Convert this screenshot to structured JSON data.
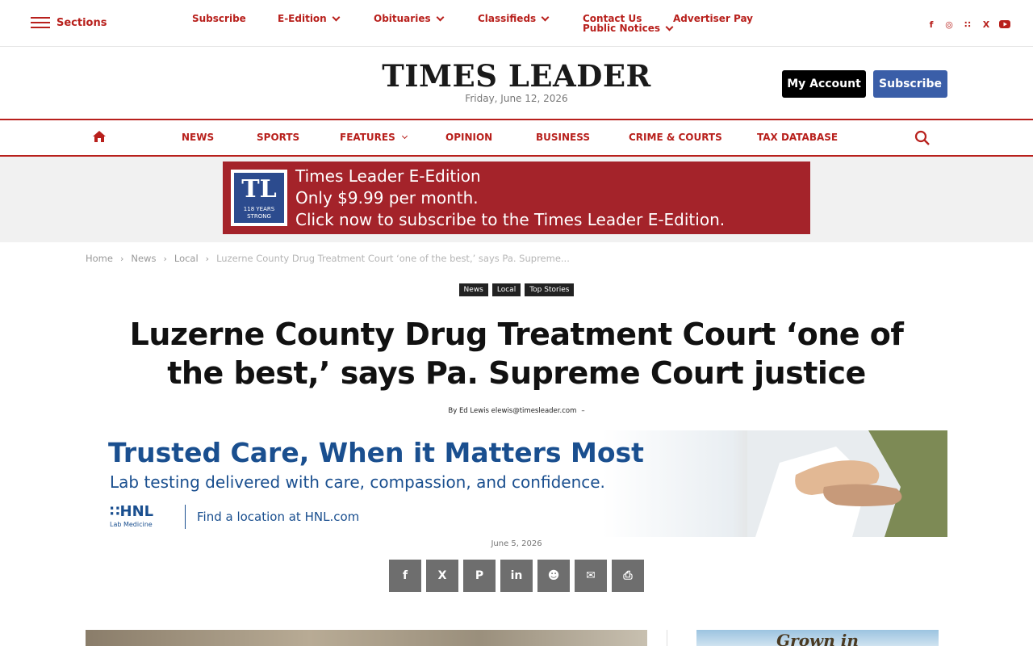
{
  "topbar": {
    "sections_label": "Sections",
    "links": {
      "subscribe": "Subscribe",
      "eedition": "E-Edition",
      "obituaries": "Obituaries",
      "classifieds": "Classifieds",
      "contact_us": "Contact Us",
      "public_notices": "Public Notices",
      "advertiser_pay": "Advertiser Pay"
    },
    "social": {
      "facebook": "f",
      "instagram": "◎",
      "rss": "∷",
      "x": "X",
      "youtube": "▶"
    }
  },
  "masthead": {
    "logo": "TIMES LEADER",
    "date": "Friday, June 12, 2026",
    "my_account": "My Account",
    "subscribe": "Subscribe"
  },
  "nav": {
    "news": "NEWS",
    "sports": "SPORTS",
    "features": "FEATURES",
    "opinion": "OPINION",
    "business": "BUSINESS",
    "crime_courts": "CRIME & COURTS",
    "tax_database": "TAX DATABASE"
  },
  "eedition_banner": {
    "badge_letters": "TL",
    "badge_years_1": "118 YEARS",
    "badge_years_2": "STRONG",
    "line1": "Times Leader E-Edition",
    "line2": "Only $9.99 per month.",
    "line3": "Click now to subscribe to the Times Leader E-Edition."
  },
  "breadcrumb": {
    "home": "Home",
    "news": "News",
    "local": "Local",
    "current": "Luzerne County Drug Treatment Court ‘one of the best,’ says Pa. Supreme...",
    "separator": "›"
  },
  "tags": [
    "News",
    "Local",
    "Top Stories"
  ],
  "article": {
    "headline": "Luzerne County Drug Treatment Court ‘one of the best,’ says Pa. Supreme Court justice",
    "byline": "By Ed Lewis elewis@timesleader.com",
    "byline_dash": "–",
    "date": "June 5, 2026"
  },
  "ad": {
    "headline": "Trusted Care, When it Matters Most",
    "subline": "Lab testing delivered with care, compassion, and confidence.",
    "logo": "∷HNL",
    "logo_sub": "Lab Medicine",
    "find": "Find a location at HNL.com"
  },
  "share": {
    "facebook": "f",
    "x": "X",
    "pinterest": "P",
    "linkedin": "in",
    "reddit": "☻",
    "email": "✉",
    "print": "⎙"
  },
  "side_ad": {
    "text": "Grown in"
  },
  "colors": {
    "brand_red": "#b8201c",
    "subscribe_blue": "#3a5ea8",
    "banner_red": "#a4232a"
  }
}
